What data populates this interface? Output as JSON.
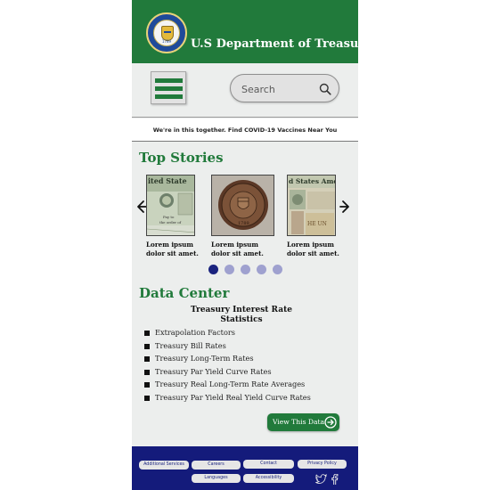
{
  "header": {
    "title": "U.S Department of Treasury",
    "seal_year": "1789",
    "brand_color": "#217a3b",
    "seal_icon": "treasury-seal-icon"
  },
  "toolbar": {
    "menu_icon": "hamburger-menu-icon",
    "search_placeholder": "Search",
    "search_icon": "search-icon"
  },
  "banner": {
    "text": "We're in this together. Find COVID-19 Vaccines Near You"
  },
  "top_stories": {
    "title": "Top Stories",
    "prev_icon": "arrow-left-icon",
    "next_icon": "arrow-right-icon",
    "cards": [
      {
        "image": "currency-note-image",
        "line1": "Lorem ipsum",
        "line2": "dolor sit amet."
      },
      {
        "image": "treasury-medal-image",
        "line1": "Lorem ipsum",
        "line2": "dolor sit amet."
      },
      {
        "image": "currency-bills-image",
        "line1": "Lorem ipsum",
        "line2": "dolor sit amet."
      }
    ],
    "pagination": {
      "active": 1,
      "total": 5,
      "active_color": "#1a237e",
      "inactive_color": "#9fa1cf"
    }
  },
  "data_center": {
    "title": "Data Center",
    "heading_line1": "Treasury Interest Rate",
    "heading_line2": "Statistics",
    "items": [
      "Extrapolation Factors",
      "Treasury Bill Rates",
      "Treasury Long-Term Rates",
      "Treasury Par Yield Curve Rates",
      "Treasury Real Long-Term Rate Averages",
      "Treasury Par Yield Real Yield Curve Rates"
    ],
    "view_button": "View This Data",
    "view_icon": "arrow-circle-right-icon"
  },
  "footer": {
    "background": "#141b7b",
    "links": [
      "Additional Services",
      "Careers",
      "Contact",
      "Privacy Policy",
      "Languages",
      "Accessibility"
    ],
    "social": [
      "twitter-icon",
      "facebook-icon"
    ]
  }
}
